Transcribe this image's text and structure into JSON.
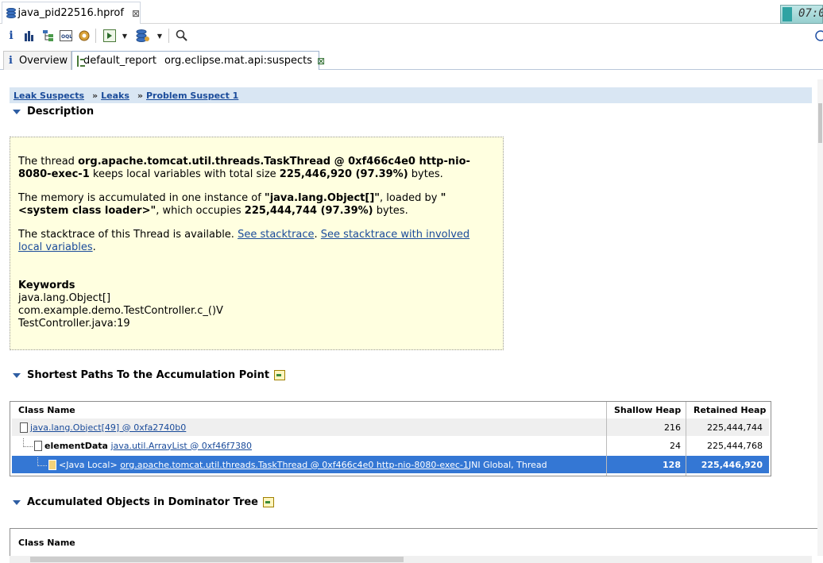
{
  "editor": {
    "file_tab": "java_pid22516.hprof",
    "close_glyph": "⊠",
    "clock_text": "07:0"
  },
  "toolbar": {
    "icons": [
      "info-icon",
      "histogram-icon",
      "dominator-tree-icon",
      "oql-icon",
      "thread-overview-icon",
      "run-report-icon",
      "dropdown-arrow",
      "heap-dump-icon",
      "dropdown-arrow",
      "search-icon"
    ]
  },
  "view_tabs": {
    "overview": "Overview",
    "report_name": "default_report",
    "report_class": "org.eclipse.mat.api:suspects"
  },
  "breadcrumb": {
    "items": [
      "Leak Suspects",
      "Leaks",
      "Problem Suspect 1"
    ],
    "separator": "»"
  },
  "description": {
    "heading": "Description",
    "p1_pre": "The thread ",
    "p1_thread": "org.apache.tomcat.util.threads.TaskThread @ 0xf466c4e0 http-nio-8080-exec-1",
    "p1_mid": " keeps local variables with total size ",
    "p1_size": "225,446,920 (97.39%)",
    "p1_post": " bytes.",
    "p2_pre": "The memory is accumulated in one instance of ",
    "p2_class": "\"java.lang.Object[]\"",
    "p2_mid": ", loaded by ",
    "p2_loader": "\"<system class loader>\"",
    "p2_mid2": ", which occupies ",
    "p2_size": "225,444,744 (97.39%)",
    "p2_post": " bytes.",
    "p3_pre": "The stacktrace of this Thread is available. ",
    "p3_link1": "See stacktrace",
    "p3_sep": ". ",
    "p3_link2": "See stacktrace with involved local variables",
    "p3_post": ".",
    "keywords_title": "Keywords",
    "keywords": [
      "java.lang.Object[]",
      "com.example.demo.TestController.c_()V",
      "TestController.java:19"
    ]
  },
  "paths": {
    "heading": "Shortest Paths To the Accumulation Point",
    "columns": [
      "Class Name",
      "Shallow Heap",
      "Retained Heap"
    ],
    "rows": [
      {
        "prefix": "",
        "link": "java.lang.Object[49] @ 0xfa2740b0",
        "suffix": "",
        "shallow": "216",
        "retained": "225,444,744"
      },
      {
        "prefix": "elementData",
        "link": "java.util.ArrayList @ 0xf46f7380",
        "suffix": "",
        "shallow": "24",
        "retained": "225,444,768"
      },
      {
        "prefix": "<Java Local>",
        "link": "org.apache.tomcat.util.threads.TaskThread @ 0xf466c4e0 http-nio-8080-exec-1",
        "suffix": " JNI Global, Thread",
        "shallow": "128",
        "retained": "225,446,920"
      }
    ]
  },
  "dominator": {
    "heading": "Accumulated Objects in Dominator Tree",
    "column": "Class Name"
  },
  "colors": {
    "selection": "#3477d4",
    "link": "#1a4b9a",
    "description_bg": "#ffffe0",
    "breadcrumb_bg": "#d9e6f3"
  }
}
